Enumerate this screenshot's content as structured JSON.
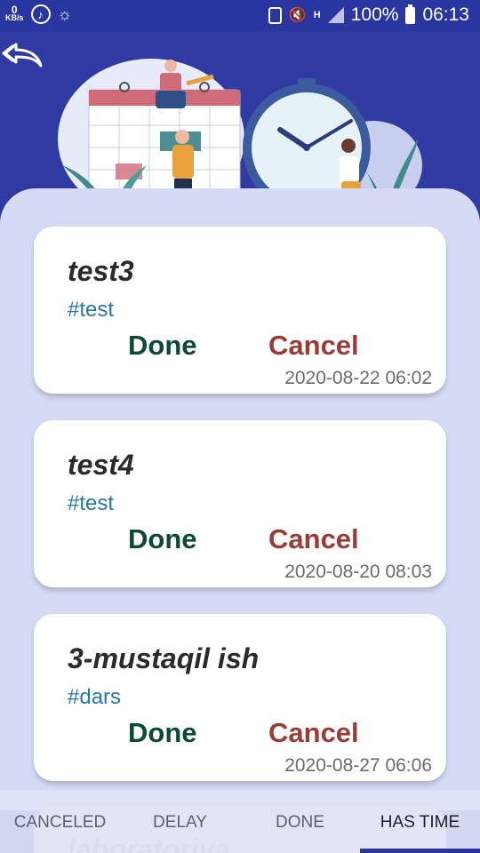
{
  "status_bar": {
    "speed_value": "0",
    "speed_unit": "KB/s",
    "battery": "100%",
    "time": "06:13",
    "network": "H"
  },
  "header": {
    "back_icon": "double-back-arrow-icon",
    "illustration": "calendar-clock-people-illustration"
  },
  "cards": [
    {
      "title": "test3",
      "tag": "#test",
      "done": "Done",
      "cancel": "Cancel",
      "date": "2020-08-22 06:02"
    },
    {
      "title": "test4",
      "tag": "#test",
      "done": "Done",
      "cancel": "Cancel",
      "date": "2020-08-20 08:03"
    },
    {
      "title": "3-mustaqil ish",
      "tag": "#dars",
      "done": "Done",
      "cancel": "Cancel",
      "date": "2020-08-27 06:06"
    }
  ],
  "peek_card": {
    "title": "laboratoriya"
  },
  "tabs": [
    {
      "label": "CANCELED"
    },
    {
      "label": "DELAY"
    },
    {
      "label": "DONE"
    },
    {
      "label": "HAS TIME",
      "active": true
    }
  ],
  "colors": {
    "header_bg": "#2f3ba3",
    "content_bg": "#d6dbf5",
    "done": "#0c4a33",
    "cancel": "#9b3b37",
    "tag": "#2678a8"
  }
}
